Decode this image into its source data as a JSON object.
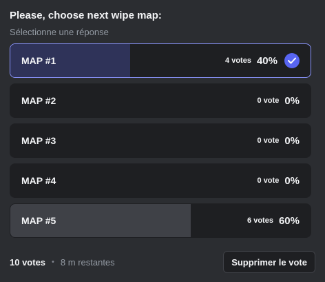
{
  "poll": {
    "question": "Please, choose next wipe map:",
    "instruction": "Sélectionne une réponse",
    "options": [
      {
        "label": "MAP #1",
        "votes": "4 votes",
        "percent": "40%",
        "fraction": 0.4,
        "selected": true
      },
      {
        "label": "MAP #2",
        "votes": "0 vote",
        "percent": "0%",
        "fraction": 0.0,
        "selected": false
      },
      {
        "label": "MAP #3",
        "votes": "0 vote",
        "percent": "0%",
        "fraction": 0.0,
        "selected": false
      },
      {
        "label": "MAP #4",
        "votes": "0 vote",
        "percent": "0%",
        "fraction": 0.0,
        "selected": false
      },
      {
        "label": "MAP #5",
        "votes": "6 votes",
        "percent": "60%",
        "fraction": 0.6,
        "selected": false
      }
    ],
    "selected_icon": "checkmark-icon"
  },
  "footer": {
    "total_votes": "10 votes",
    "separator": "•",
    "time_remaining": "8 m restantes",
    "remove_vote_label": "Supprimer le vote"
  },
  "colors": {
    "accent": "#5865f2",
    "selected_border": "#8c96ff",
    "background": "#2b2d31",
    "option_background": "#1e1f22"
  }
}
